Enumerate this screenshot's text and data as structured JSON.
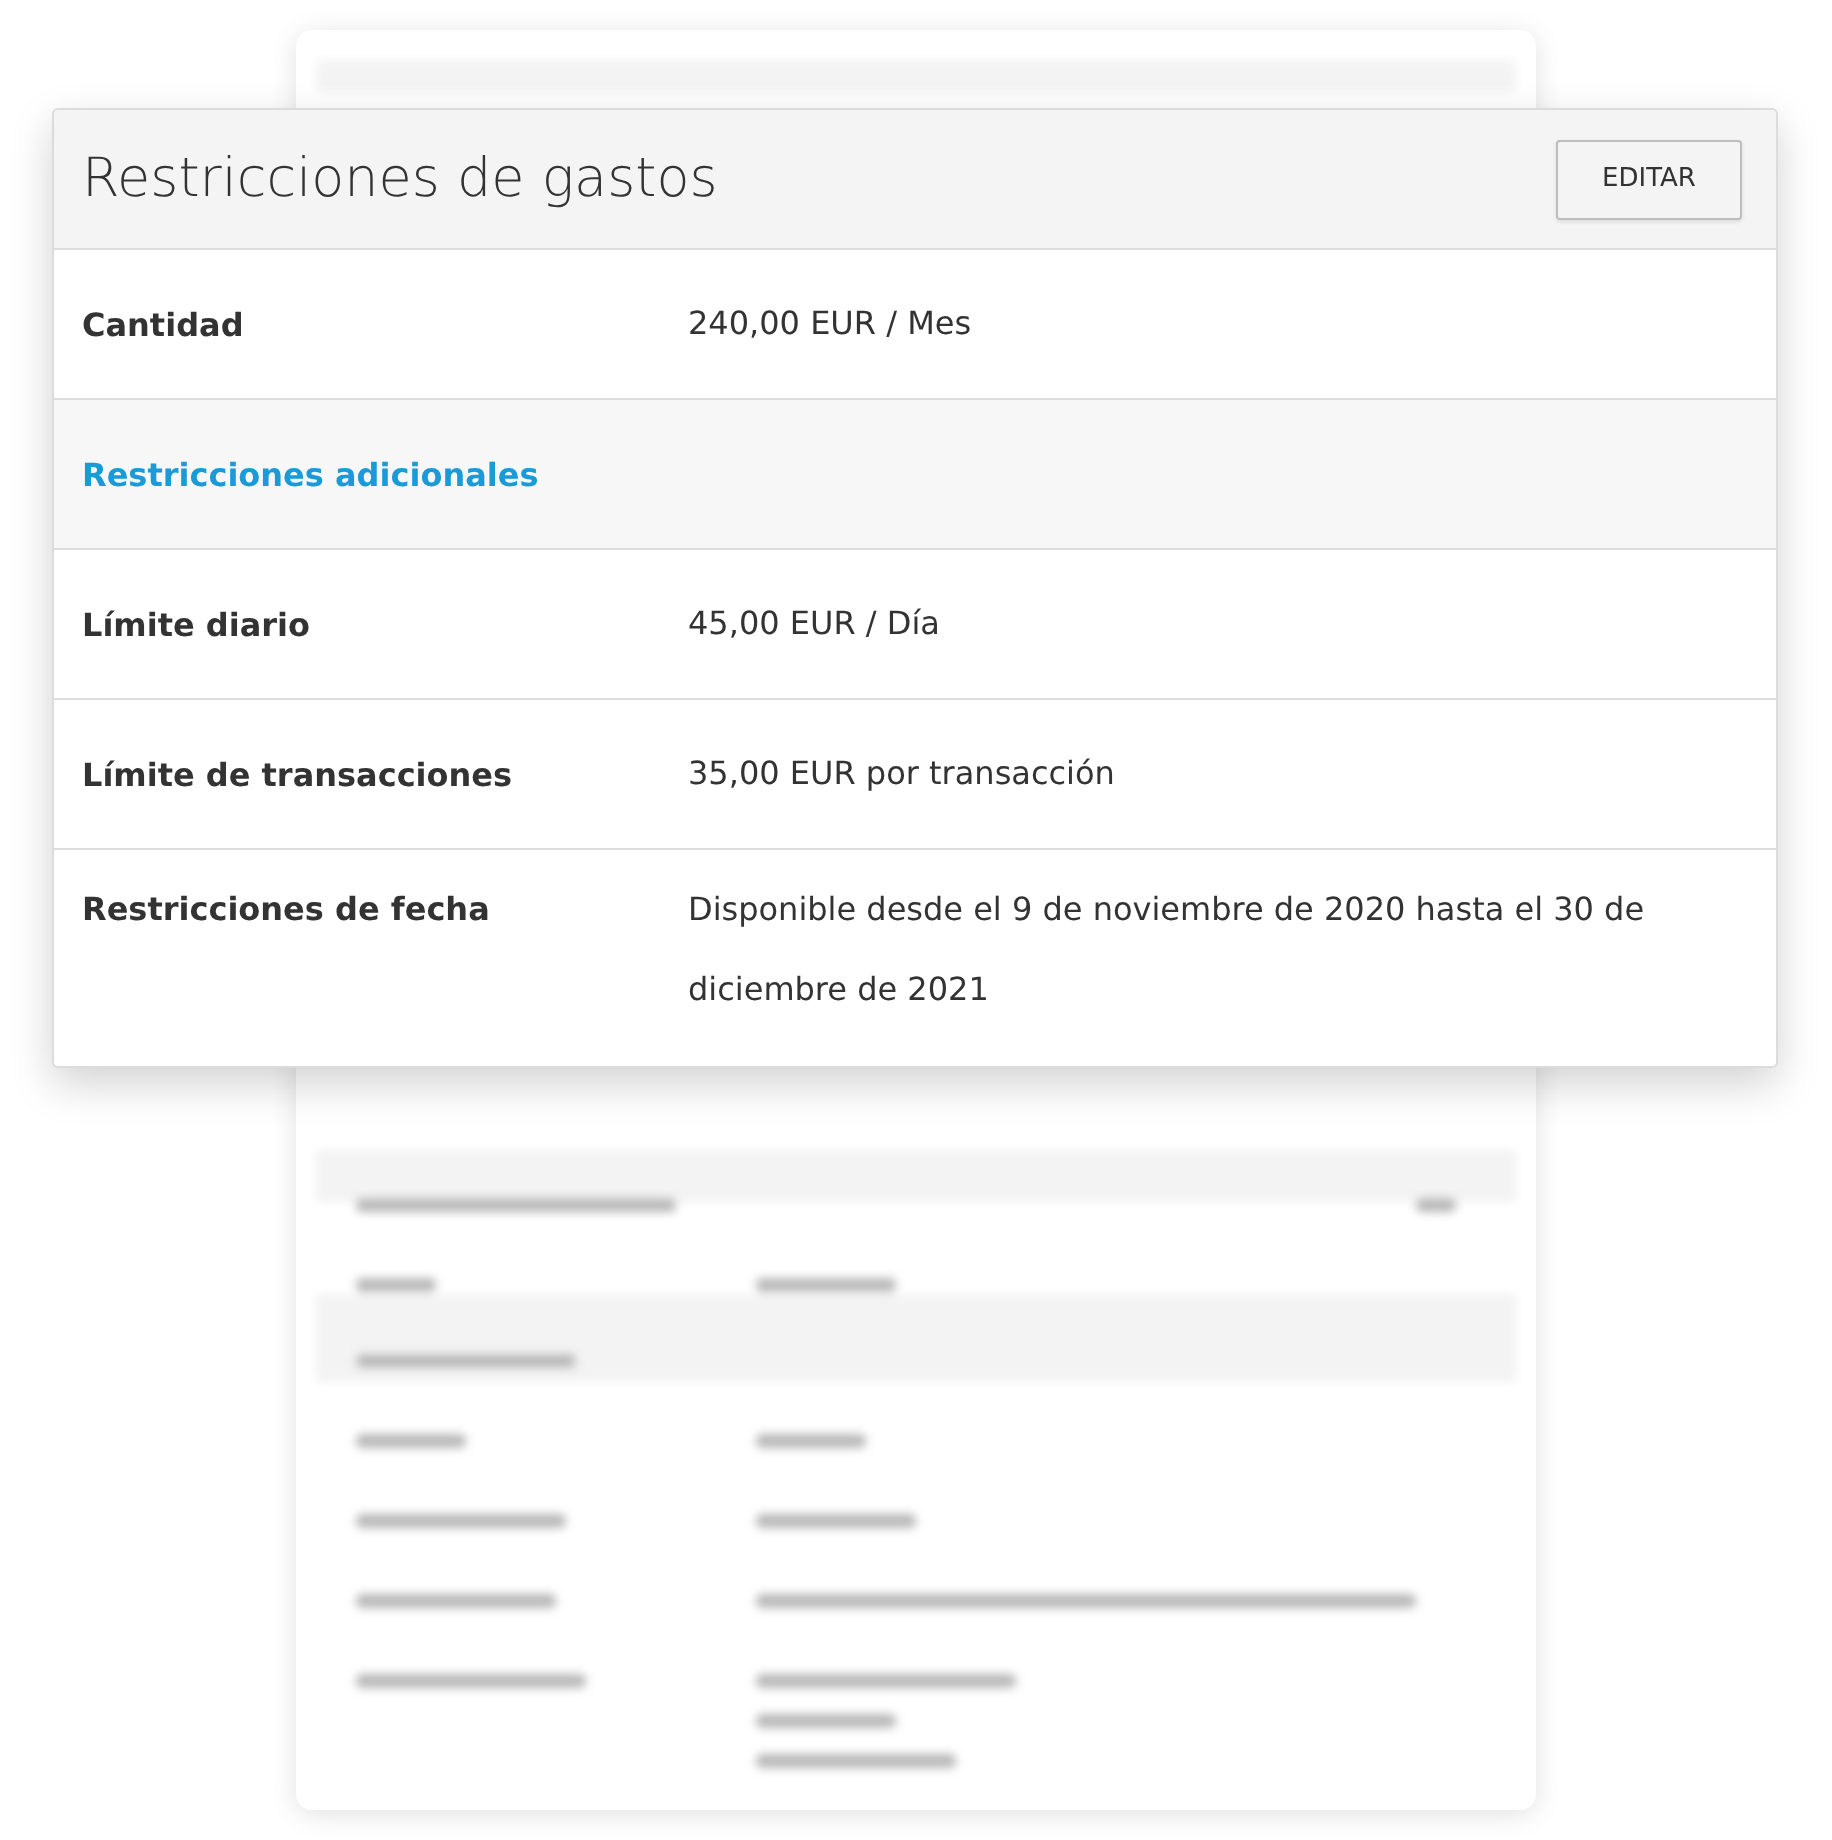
{
  "card": {
    "title": "Restricciones de gastos",
    "edit_button": "EDITAR",
    "rows": [
      {
        "kind": "field",
        "label": "Cantidad",
        "value": "240,00 EUR / Mes"
      },
      {
        "kind": "section",
        "label": "Restricciones adicionales"
      },
      {
        "kind": "field",
        "label": "Límite diario",
        "value": "45,00 EUR / Día"
      },
      {
        "kind": "field",
        "label": "Límite de transacciones",
        "value": "35,00 EUR por transacción"
      },
      {
        "kind": "field",
        "label": "Restricciones de fecha",
        "value": "Disponible desde el 9 de noviembre de 2020 hasta el 30 de diciembre de 2021"
      }
    ]
  }
}
